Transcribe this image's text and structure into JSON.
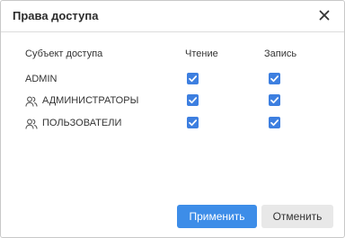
{
  "dialog": {
    "title": "Права доступа",
    "close_icon": "close-icon"
  },
  "table": {
    "headers": {
      "subject": "Субъект доступа",
      "read": "Чтение",
      "write": "Запись"
    },
    "rows": [
      {
        "label": "ADMIN",
        "icon": null,
        "read": true,
        "write": true
      },
      {
        "label": "АДМИНИСТРАТОРЫ",
        "icon": "users-icon",
        "read": true,
        "write": true
      },
      {
        "label": "ПОЛЬЗОВАТЕЛИ",
        "icon": "users-icon",
        "read": true,
        "write": true
      }
    ]
  },
  "buttons": {
    "apply_label": "Применить",
    "cancel_label": "Отменить"
  },
  "colors": {
    "accent": "#3d8de8",
    "checkbox": "#3d7fe0"
  }
}
